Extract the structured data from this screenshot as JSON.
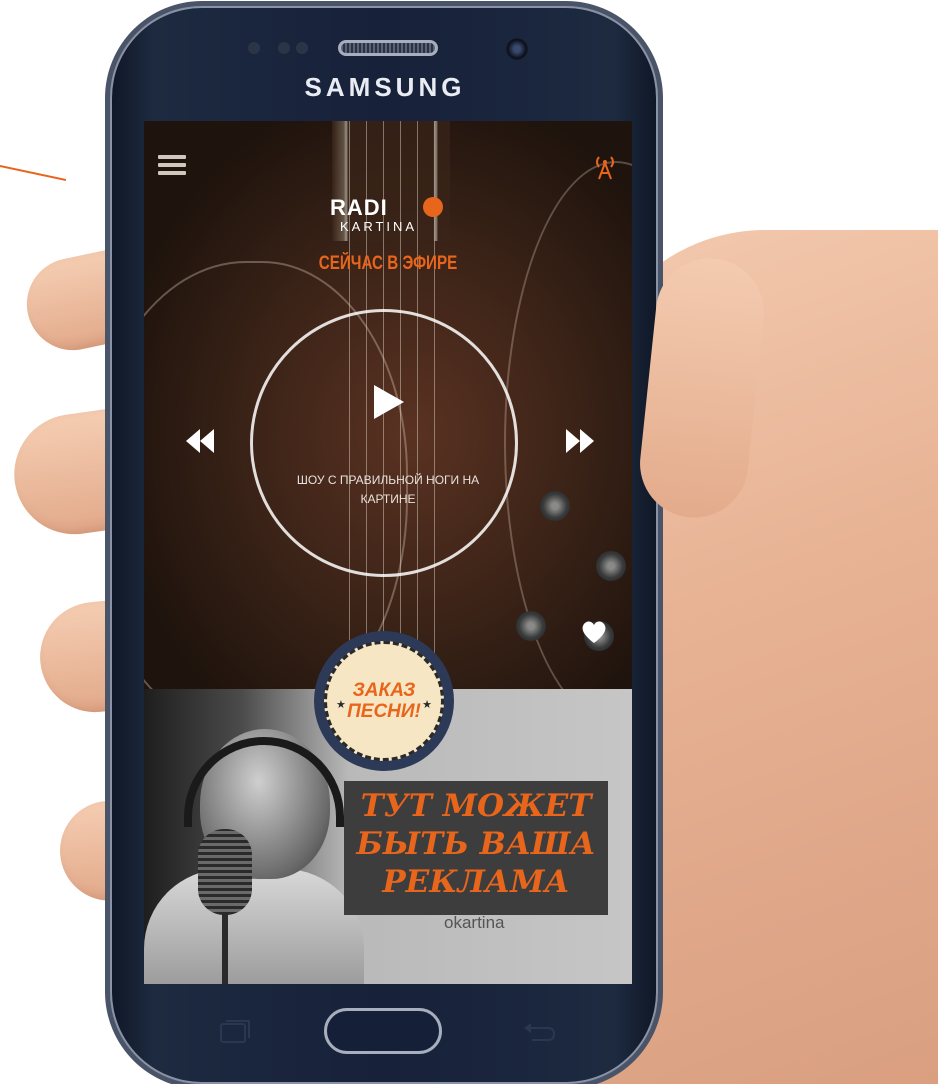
{
  "device": {
    "brand": "SAMSUNG"
  },
  "app": {
    "logo_text": "RADI",
    "logo_subtext": "KARTINA",
    "on_air_label": "СЕЙЧАС В ЭФИРЕ",
    "show_title": "ШОУ С ПРАВИЛЬНОЙ НОГИ НА КАРТИНЕ",
    "order_song_label": "ЗАКАЗ ПЕСНИ!",
    "ad_text": "ТУТ МОЖЕТ БЫТЬ ВАША РЕКЛАМА",
    "banner_watermark": "okartina"
  },
  "colors": {
    "accent": "#e8651c",
    "phone_body": "#17213a",
    "badge_background": "#f7e6c3"
  },
  "icons": {
    "menu": "menu-icon",
    "antenna": "antenna-icon",
    "play": "play-icon",
    "rewind": "rewind-icon",
    "fast_forward": "fast-forward-icon",
    "favorite": "heart-icon"
  }
}
